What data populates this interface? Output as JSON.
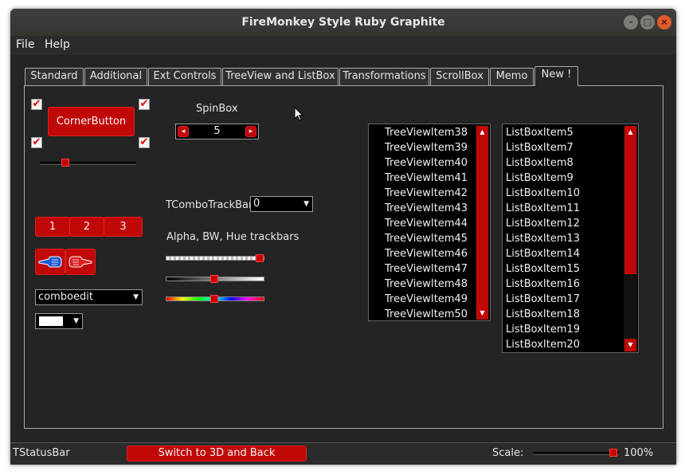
{
  "window": {
    "title": "FireMonkey Style Ruby Graphite",
    "controls": [
      "–",
      "□",
      "×"
    ]
  },
  "menu": {
    "file": "File",
    "help": "Help"
  },
  "tabs": [
    "Standard",
    "Additional",
    "Ext Controls",
    "TreeView and ListBox",
    "Transformations",
    "ScrollBox",
    "Memo",
    "New !"
  ],
  "active_tab": "New !",
  "panel": {
    "corner_button": "CornerButton",
    "spinbox_label": "SpinBox",
    "spinbox_value": "5",
    "spin_left": "◂",
    "spin_right": "▸",
    "check_mark": "✔",
    "segments": [
      "1",
      "2",
      "3"
    ],
    "combo_trackbar_label": "TComboTrackBar:",
    "combo_trackbar_value": "0",
    "alpha_label": "Alpha, BW, Hue trackbars",
    "comboedit_value": "comboedit",
    "dropdown_arrow": "▼",
    "treeview_items": [
      "TreeViewItem38",
      "TreeViewItem39",
      "TreeViewItem40",
      "TreeViewItem41",
      "TreeViewItem42",
      "TreeViewItem43",
      "TreeViewItem44",
      "TreeViewItem45",
      "TreeViewItem46",
      "TreeViewItem47",
      "TreeViewItem48",
      "TreeViewItem49",
      "TreeViewItem50"
    ],
    "listbox_items": [
      "ListBoxItem5",
      "ListBoxItem7",
      "ListBoxItem8",
      "ListBoxItem9",
      "ListBoxItem10",
      "ListBoxItem11",
      "ListBoxItem12",
      "ListBoxItem13",
      "ListBoxItem14",
      "ListBoxItem15",
      "ListBoxItem16",
      "ListBoxItem17",
      "ListBoxItem18",
      "ListBoxItem19",
      "ListBoxItem20"
    ],
    "scroll_up": "▲",
    "scroll_down": "▼"
  },
  "statusbar": {
    "label": "TStatusBar",
    "button": "Switch to 3D and Back",
    "scale_label": "Scale:",
    "scale_value": "100%"
  },
  "colors": {
    "accent": "#c00808",
    "background": "#242424",
    "chrome": "#2b2b2b"
  }
}
